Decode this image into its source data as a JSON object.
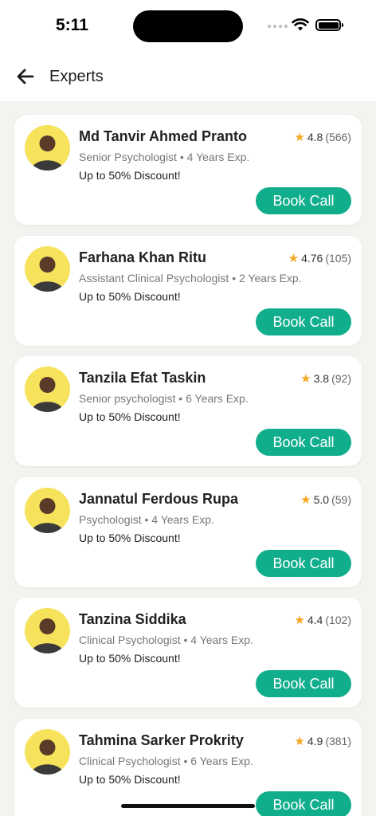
{
  "status_bar": {
    "time": "5:11"
  },
  "header": {
    "title": "Experts"
  },
  "experts": [
    {
      "name": "Md Tanvir Ahmed Pranto",
      "rating": "4.8",
      "reviews": "(566)",
      "title": "Senior Psychologist",
      "experience": "4 Years Exp.",
      "discount": "Up to 50% Discount!",
      "book_label": "Book Call"
    },
    {
      "name": "Farhana Khan Ritu",
      "rating": "4.76",
      "reviews": "(105)",
      "title": "Assistant Clinical Psychologist",
      "experience": "2 Years Exp.",
      "discount": "Up to 50% Discount!",
      "book_label": "Book Call"
    },
    {
      "name": "Tanzila Efat Taskin",
      "rating": "3.8",
      "reviews": "(92)",
      "title": "Senior psychologist",
      "experience": "6 Years Exp.",
      "discount": "Up to 50% Discount!",
      "book_label": "Book Call"
    },
    {
      "name": "Jannatul Ferdous Rupa",
      "rating": "5.0",
      "reviews": "(59)",
      "title": "Psychologist",
      "experience": "4 Years Exp.",
      "discount": "Up to 50% Discount!",
      "book_label": "Book Call"
    },
    {
      "name": "Tanzina Siddika",
      "rating": "4.4",
      "reviews": "(102)",
      "title": "Clinical Psychologist",
      "experience": "4 Years Exp.",
      "discount": "Up to 50% Discount!",
      "book_label": "Book Call"
    },
    {
      "name": "Tahmina Sarker Prokrity",
      "rating": "4.9",
      "reviews": "(381)",
      "title": "Clinical Psychologist",
      "experience": "6 Years Exp.",
      "discount": "Up to 50% Discount!",
      "book_label": "Book Call"
    }
  ],
  "separator": "•",
  "colors": {
    "accent": "#11ae8c",
    "star": "#f5a623",
    "avatar_bg": "#f7e25c",
    "page_bg": "#f5f3f0"
  },
  "icons": {
    "back": "arrow-left-icon",
    "star": "star-icon",
    "avatar": "avatar-photo"
  }
}
